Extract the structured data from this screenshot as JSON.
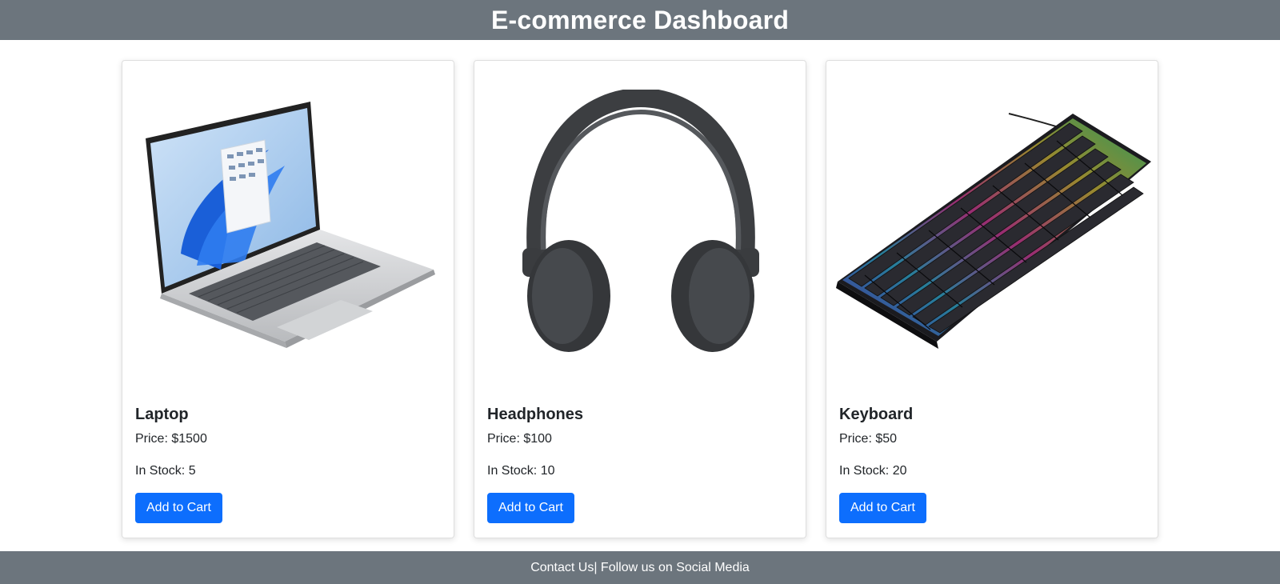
{
  "header": {
    "title": "E-commerce Dashboard"
  },
  "products": [
    {
      "name": "Laptop",
      "price": "Price: $1500",
      "stock": "In Stock: 5",
      "button": "Add to Cart",
      "image": "laptop-image"
    },
    {
      "name": "Headphones",
      "price": "Price: $100",
      "stock": "In Stock: 10",
      "button": "Add to Cart",
      "image": "headphones-image"
    },
    {
      "name": "Keyboard",
      "price": "Price: $50",
      "stock": "In Stock: 20",
      "button": "Add to Cart",
      "image": "keyboard-image"
    }
  ],
  "footer": {
    "text": "Contact Us| Follow us on Social Media"
  },
  "colors": {
    "header_bg": "#6c757d",
    "footer_bg": "#6c757d",
    "button_bg": "#0d6efd",
    "button_text": "#ffffff"
  }
}
